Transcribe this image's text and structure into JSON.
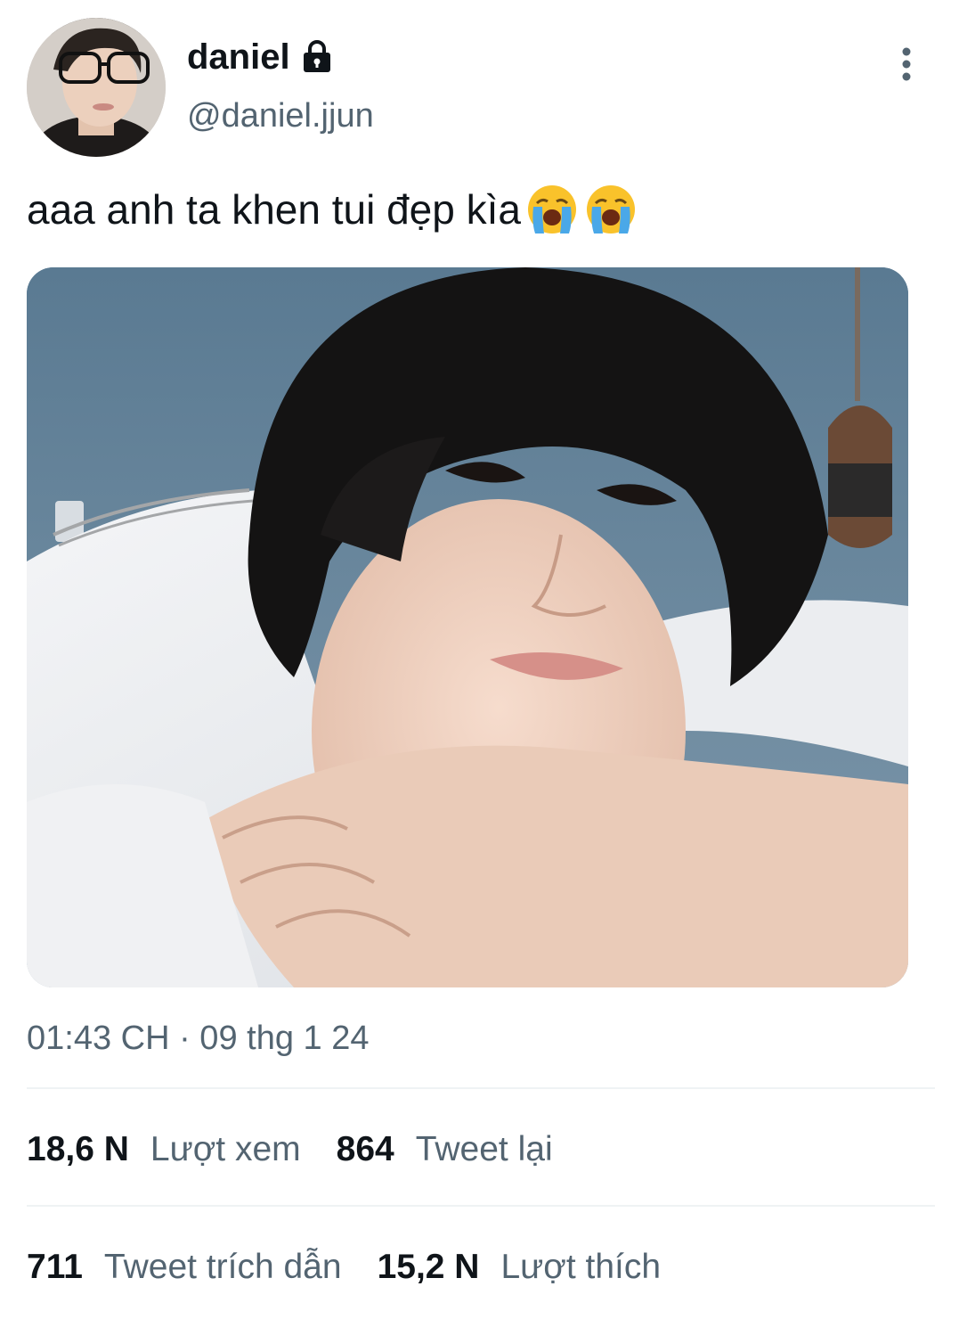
{
  "tweet": {
    "author": {
      "display_name": "daniel",
      "handle": "@daniel.jjun",
      "protected_icon": "lock-icon"
    },
    "text": "aaa anh ta khen tui đẹp kìa",
    "text_emojis": [
      "loudly-crying-face-emoji",
      "loudly-crying-face-emoji"
    ],
    "media_alt_description": "photo",
    "timestamp": "01:43 CH · 09 thg 1 24"
  },
  "stats": {
    "views_value": "18,6 N",
    "views_label": "Lượt xem",
    "retweets_value": "864",
    "retweets_label": "Tweet lại",
    "quotes_value": "711",
    "quotes_label": "Tweet trích dẫn",
    "likes_value": "15,2 N",
    "likes_label": "Lượt thích"
  },
  "icons": {
    "more": "more-vertical-icon"
  },
  "colors": {
    "primary_text": "#0f1419",
    "secondary_text": "#536471",
    "divider": "#eff3f4",
    "emoji_face": "#f9c22b",
    "emoji_tears": "#4aa8e8"
  }
}
